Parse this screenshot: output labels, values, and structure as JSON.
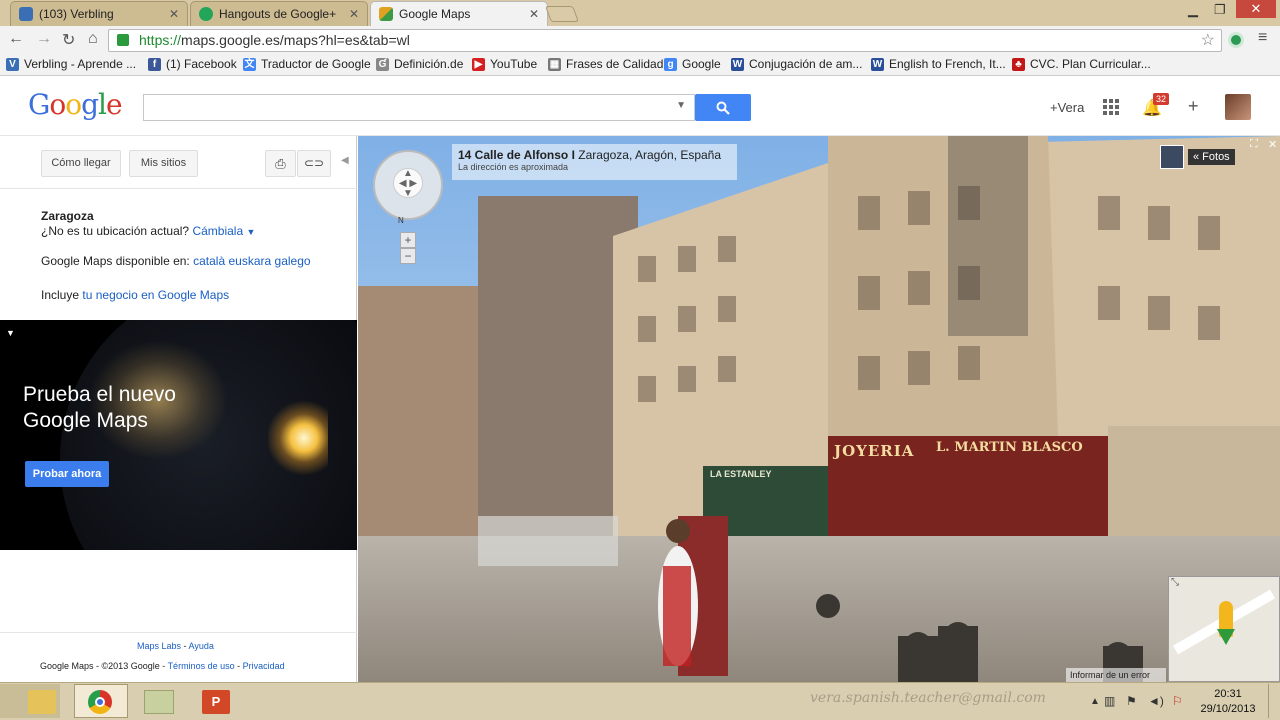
{
  "browser": {
    "tabs": [
      {
        "label": "(103) Verbling",
        "color": "#3a6fb5"
      },
      {
        "label": "Hangouts de Google+",
        "color": "#23a55a"
      },
      {
        "label": "Google Maps",
        "color": "#e0a020"
      }
    ],
    "url_scheme": "https://",
    "url_rest": "maps.google.es/maps?hl=es&tab=wl",
    "bookmarks": [
      {
        "label": "Verbling - Aprende ...",
        "color": "#3a6fb5",
        "icon": "V"
      },
      {
        "label": "(1) Facebook",
        "color": "#3b5998",
        "icon": "f"
      },
      {
        "label": "Traductor de Google",
        "color": "#4285f4",
        "icon": "文"
      },
      {
        "label": "Definición.de",
        "color": "#888888",
        "icon": "Ɠ"
      },
      {
        "label": "YouTube",
        "color": "#d42020",
        "icon": "▶"
      },
      {
        "label": "Frases de Calidad",
        "color": "#777777",
        "icon": "▦"
      },
      {
        "label": "Google",
        "color": "#4285f4",
        "icon": "g"
      },
      {
        "label": "Conjugación de am...",
        "color": "#2a4f9a",
        "icon": "W"
      },
      {
        "label": "English to French, It...",
        "color": "#2a4f9a",
        "icon": "W"
      },
      {
        "label": "CVC. Plan Curricular...",
        "color": "#c21818",
        "icon": "♣"
      }
    ]
  },
  "header": {
    "logo_letters": [
      {
        "ch": "G",
        "color": "#3b6fd9"
      },
      {
        "ch": "o",
        "color": "#d8342a"
      },
      {
        "ch": "o",
        "color": "#f1b513"
      },
      {
        "ch": "g",
        "color": "#3b6fd9"
      },
      {
        "ch": "l",
        "color": "#289d4a"
      },
      {
        "ch": "e",
        "color": "#d8342a"
      }
    ],
    "search_value": "",
    "plus_name": "+Vera",
    "notif_count": "32"
  },
  "sidebar": {
    "directions_label": "Cómo llegar",
    "my_places_label": "Mis sitios",
    "location_city": "Zaragoza",
    "location_question": "¿No es tu ubicación actual?",
    "location_change": "Cámbiala",
    "langs_prefix": "Google Maps disponible en:",
    "langs": [
      "català",
      "euskara",
      "galego"
    ],
    "business_prefix": "Incluye",
    "business_link": "tu negocio en Google Maps",
    "promo_title_1": "Prueba el nuevo",
    "promo_title_2": "Google Maps",
    "promo_button": "Probar ahora",
    "footer_labs": "Maps Labs",
    "footer_help": "Ayuda",
    "footer_brand": "Google Maps",
    "footer_copy": "- ©2013 Google -",
    "footer_terms": "Términos de uso",
    "footer_privacy": "Privacidad"
  },
  "map": {
    "address_bold": "14 Calle de Alfonso I",
    "address_region": "Zaragoza, Aragón, España",
    "address_note": "La dirección es aproximada",
    "photos_label": "« Fotos",
    "report_error": "Informar de un error",
    "sign_joyeria": "JOYERIA",
    "sign_martin": "L. MARTIN BLASCO",
    "sign_other": "LA ESTANLEY",
    "compass_n": "N",
    "watermark": "vera.spanish.teacher@gmail.com"
  },
  "taskbar": {
    "time": "20:31",
    "date": "29/10/2013"
  }
}
